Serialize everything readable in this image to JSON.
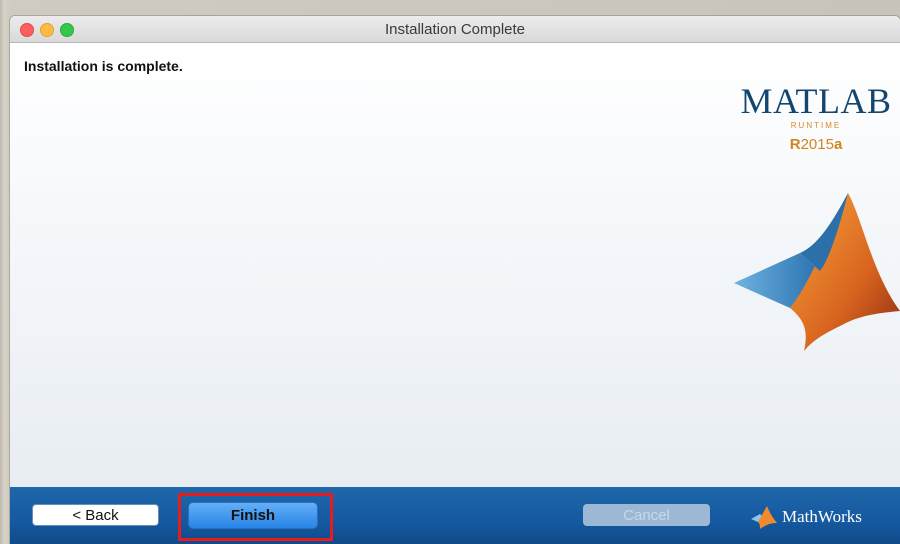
{
  "window": {
    "title": "Installation Complete"
  },
  "content": {
    "message": "Installation is complete.",
    "logo": {
      "brand": "MATLAB",
      "product": "RUNTIME",
      "release_prefix": "R",
      "release_year": "2015",
      "release_suffix": "a"
    }
  },
  "footer": {
    "back_label": "< Back",
    "finish_label": "Finish",
    "cancel_label": "Cancel",
    "vendor": "MathWorks"
  },
  "colors": {
    "footer_blue": "#1559a0",
    "finish_blue": "#2784e6",
    "highlight_red": "#e81b1f",
    "logo_navy": "#13466f",
    "logo_orange": "#d1861b"
  }
}
